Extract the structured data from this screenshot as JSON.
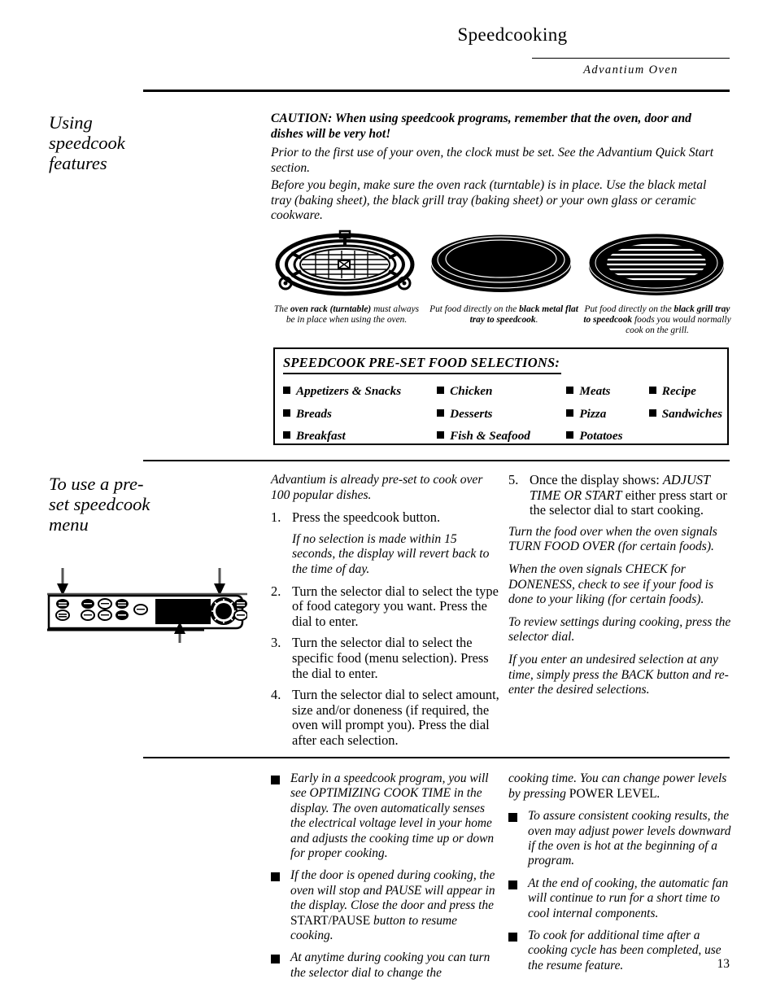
{
  "header": {
    "title": "Speedcooking",
    "subtitle": "Advantium Oven"
  },
  "section1": {
    "heading": "Using\nspeedcook\nfeatures",
    "caution": "CAUTION: When using speedcook programs, remember that the oven, door and dishes will be very hot!",
    "para1": "Prior to the first use of your oven, the clock must be set. See the Advantium Quick Start section.",
    "para2": "Before you begin, make sure the oven rack (turntable) is in place. Use the black metal tray (baking sheet), the black grill tray (baking sheet) or your own glass or ceramic cookware.",
    "figures": [
      {
        "name": "oven-rack-turntable",
        "caption_pre": "The ",
        "caption_bold": "oven rack (turntable)",
        "caption_post": " must always be in place when using the oven."
      },
      {
        "name": "black-metal-flat-tray",
        "caption_pre": "Put food directly on the ",
        "caption_bold": "black metal flat tray to speedcook",
        "caption_post": "."
      },
      {
        "name": "black-grill-tray",
        "caption_pre": "Put food directly on the ",
        "caption_bold": "black grill tray to speedcook",
        "caption_post": " foods you would normally cook on the grill."
      }
    ],
    "preset_box": {
      "title": "SPEEDCOOK PRE-SET FOOD SELECTIONS:",
      "columns": [
        [
          "Appetizers & Snacks",
          "Breads",
          "Breakfast"
        ],
        [
          "Chicken",
          "Desserts",
          "Fish & Seafood"
        ],
        [
          "Meats",
          "Pizza",
          "Potatoes"
        ],
        [
          "Recipe",
          "Sandwiches"
        ]
      ]
    }
  },
  "section2": {
    "heading": "To use a pre-\nset speedcook\nmenu",
    "intro": "Advantium is already pre-set to cook over 100 popular dishes.",
    "steps": [
      {
        "num": "1.",
        "text": "Press the speedcook button."
      },
      {
        "num": "2.",
        "text": "Turn the selector dial to select the type of food category you want. Press the dial to enter."
      },
      {
        "num": "3.",
        "text": "Turn the selector dial to select the specific food (menu selection). Press the dial to enter."
      },
      {
        "num": "4.",
        "text": "Turn the selector dial to select amount, size and/or doneness (if required, the oven will prompt you). Press the dial after each selection."
      }
    ],
    "step1_note": "If no selection is made within 15 seconds, the display will revert back to the time of day.",
    "step5": {
      "num": "5.",
      "part1": "Once the display shows: ",
      "emphasis": "ADJUST TIME OR START",
      "part2": " either press start or the selector dial to start cooking."
    },
    "notes_right": [
      "Turn the food over when the oven signals TURN FOOD OVER (for certain foods).",
      "When the oven signals CHECK for DONENESS, check to see if your food is done to your liking (for certain foods).",
      "To review settings during cooking, press the selector dial.",
      "If you enter an undesired selection at any time, simply press the BACK button and re-enter the desired selections."
    ],
    "control_panel": {
      "name": "oven-control-panel-diagram",
      "display_label": "",
      "arrows": [
        "speedcook-button-arrow",
        "selector-dial-arrow",
        "start-pause-button-arrow"
      ]
    }
  },
  "section3": {
    "bullets_left": [
      {
        "part1": "Early in a speedcook program, you will see OPTIMIZING COOK TIME in the display. The oven automatically senses the electrical voltage level in your home and adjusts the cooking time up or down for proper cooking.",
        "upright": "",
        "part2": ""
      },
      {
        "part1": "If the door is opened during cooking, the oven will stop and PAUSE will appear in the display. Close the door and press the ",
        "upright": "START/PAUSE",
        "part2": " button to resume cooking."
      },
      {
        "part1": "At anytime during cooking you can turn the selector dial to change the cooking time. You can change power levels by pressing ",
        "upright": "POWER LEVEL",
        "part2": "."
      }
    ],
    "bullets_right": [
      {
        "part1": "To assure consistent cooking results, the oven may adjust power levels downward if the oven is hot at the beginning of a program.",
        "upright": "",
        "part2": ""
      },
      {
        "part1": "At the end of cooking, the automatic fan will continue to run for a short time to cool internal components.",
        "upright": "",
        "part2": ""
      },
      {
        "part1": "To cook for additional time after a cooking cycle has been completed, use the resume feature.",
        "upright": "",
        "part2": ""
      }
    ]
  },
  "page_number": "13"
}
